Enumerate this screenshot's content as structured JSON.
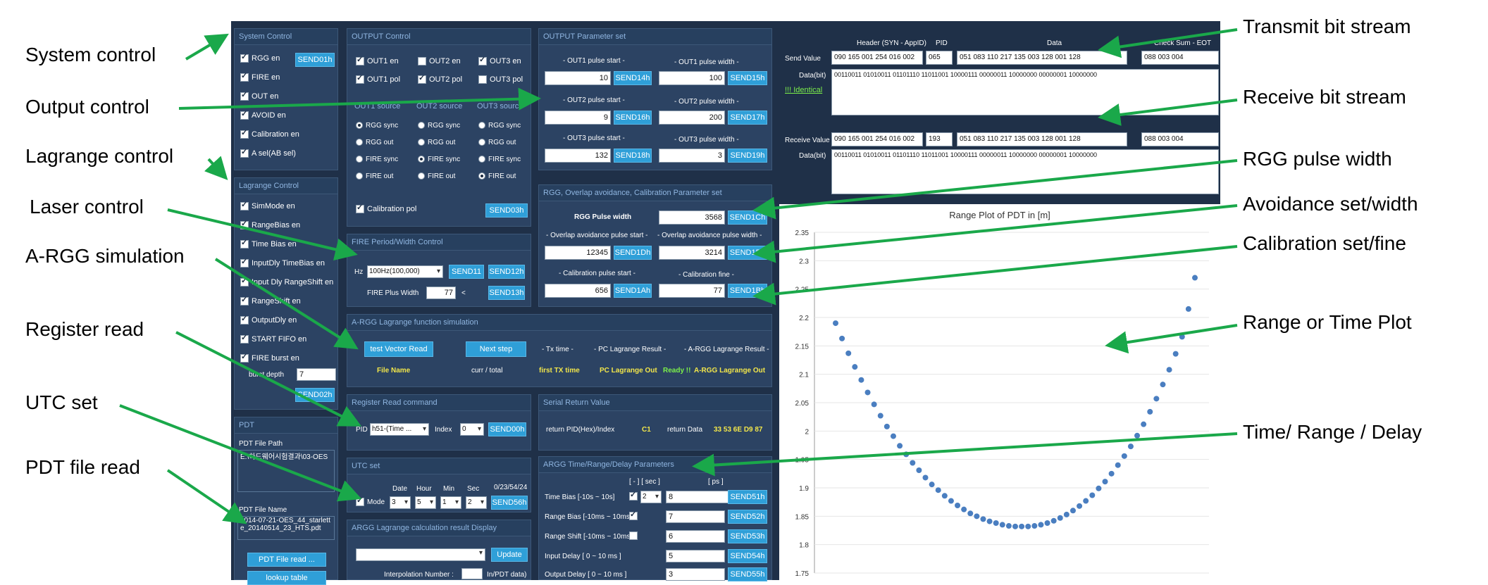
{
  "system": {
    "title": "System Control",
    "items": [
      "RGG en",
      "FIRE en",
      "OUT en",
      "AVOID en",
      "Calibration en",
      "A sel(AB sel)"
    ],
    "send": "SEND01h"
  },
  "lagrange_ctrl": {
    "title": "Lagrange Control",
    "items": [
      "SimMode en",
      "RangeBias en",
      "Time Bias en",
      "InputDly TimeBias en",
      "Input Dly RangeShift en",
      "RangeShift en",
      "OutputDly en",
      "START FIFO en",
      "FIRE burst en"
    ],
    "burst_label": "burst depth",
    "burst_value": "7",
    "send": "SEND02h"
  },
  "pdt": {
    "title": "PDT",
    "path_label": "PDT File Path",
    "path_value": "E:\\하드웨어시험결과\\03-OES",
    "name_label": "PDT File Name",
    "name_value": "2014-07-21-OES_44_starlette_20140514_23_HTS.pdt",
    "read_btn": "PDT File read ...",
    "lookup_btn": "lookup table"
  },
  "output_ctrl": {
    "title": "OUTPUT Control",
    "row1": [
      "OUT1 en",
      "OUT2 en",
      "OUT3 en"
    ],
    "row2": [
      "OUT1 pol",
      "OUT2 pol",
      "OUT3 pol"
    ],
    "src_heads": [
      "OUT1 source",
      "OUT2 source",
      "OUT3 source"
    ],
    "src_opts": [
      "RGG sync",
      "RGG out",
      "FIRE sync",
      "FIRE out"
    ],
    "cal_pol": "Calibration pol",
    "send": "SEND03h"
  },
  "fire": {
    "title": "FIRE Period/Width Control",
    "hz": "Hz",
    "hz_value": "100Hz(100,000)",
    "send11": "SEND11",
    "send12": "SEND12h",
    "width_label": "FIRE Plus Width",
    "width_value": "77",
    "lt": "<",
    "send13": "SEND13h"
  },
  "out_param": {
    "title": "OUTPUT Parameter set",
    "rows": [
      {
        "l_label": "- OUT1 pulse start -",
        "l_val": "10",
        "l_btn": "SEND14h",
        "r_label": "- OUT1 pulse width -",
        "r_val": "100",
        "r_btn": "SEND15h"
      },
      {
        "l_label": "- OUT2 pulse start -",
        "l_val": "9",
        "l_btn": "SEND16h",
        "r_label": "- OUT2 pulse width -",
        "r_val": "200",
        "r_btn": "SEND17h"
      },
      {
        "l_label": "- OUT3 pulse start -",
        "l_val": "132",
        "l_btn": "SEND18h",
        "r_label": "- OUT3 pulse width -",
        "r_val": "3",
        "r_btn": "SEND19h"
      }
    ]
  },
  "rgg_param": {
    "title": "RGG, Overlap avoidance, Calibration Parameter set",
    "pw_label": "RGG Pulse width",
    "pw_val": "3568",
    "pw_btn": "SEND1Ch",
    "oa_start_label": "- Overlap avoidance pulse start -",
    "oa_width_label": "- Overlap avoidance pulse width -",
    "oa_start_val": "12345",
    "oa_start_btn": "SEND1Dh",
    "oa_width_val": "3214",
    "oa_width_btn": "SEND1Eh",
    "cal_start_label": "- Calibration pulse start -",
    "cal_fine_label": "- Calibration fine -",
    "cal_start_val": "656",
    "cal_start_btn": "SEND1Ah",
    "cal_fine_val": "77",
    "cal_fine_btn": "SEND1Bh"
  },
  "argg_sim": {
    "title": "A-RGG Lagrange function simulation",
    "btn_test": "test Vector Read",
    "btn_next": "Next step",
    "tx_time": "- Tx time -",
    "pc_result": "- PC Lagrange Result -",
    "argg_result": "- A-RGG Lagrange Result -",
    "file_name": "File Name",
    "curr_total": "curr / total",
    "first_tx": "first TX time",
    "pc_out": "PC Lagrange Out",
    "ready": "Ready !!",
    "argg_out": "A-RGG Lagrange Out"
  },
  "reg_read": {
    "title": "Register Read command",
    "pid": "PID",
    "pid_val": "h51-(Time ...",
    "index": "Index",
    "index_val": "0",
    "send": "SEND00h"
  },
  "serial": {
    "title": "Serial Return Value",
    "ret_pid": "return PID(Hex)/Index",
    "ret_pid_val": "C1",
    "ret_data": "return Data",
    "ret_data_val": "33 53 6E D9 87"
  },
  "utc": {
    "title": "UTC set",
    "heads": [
      "Date",
      "Hour",
      "Min",
      "Sec"
    ],
    "display": "0/23/54/24",
    "mode": "Mode",
    "vals": [
      "3",
      "5",
      "1",
      "2"
    ],
    "send": "SEND56h"
  },
  "argg_calc": {
    "title": "ARGG Lagrange calculation result Display",
    "update": "Update",
    "interp": "Interpolation Number :",
    "pdt_data": "In/PDT data)"
  },
  "trd": {
    "title": "ARGG Time/Range/Delay Parameters",
    "hdr1": "[ - ]  [ sec ]",
    "hdr2": "[ ps ]",
    "rows": [
      {
        "label": "Time Bias [-10s ~ 10s]",
        "sec": "2",
        "val": "8",
        "btn": "SEND51h"
      },
      {
        "label": "Range Bias [-10ms ~ 10ms",
        "val": "7",
        "btn": "SEND52h"
      },
      {
        "label": "Range Shift [-10ms ~ 10ms",
        "val": "6",
        "btn": "SEND53h"
      },
      {
        "label": "Input Delay [ 0 ~ 10 ms ]",
        "val": "5",
        "btn": "SEND54h"
      },
      {
        "label": "Output Delay [ 0 ~ 10 ms ]",
        "val": "3",
        "btn": "SEND55h"
      }
    ]
  },
  "stream": {
    "hdr_header": "Header (SYN - AppID)",
    "hdr_pid": "PID",
    "hdr_data": "Data",
    "hdr_chk": "Check Sum - EOT",
    "send_label": "Send Value",
    "send_vals": [
      "090 165 001 254 016 002",
      "065",
      "051 083 110 217 135 003 128 001 128",
      "088 003 004"
    ],
    "data_bit": "Data(bit)",
    "send_bits": "00110011 01010011 01101110 11011001 10000111 00000011 10000000 00000001 10000000",
    "identical": "!!! Identical",
    "recv_label": "Receive Value",
    "recv_vals": [
      "090 165 001 254 016 002",
      "193",
      "051 083 110 217 135 003 128 001 128",
      "088 003 004"
    ],
    "recv_bits": "00110011 01010011 01101110 11011001 10000111 00000011 10000000 00000001 10000000"
  },
  "chart_data": {
    "type": "scatter",
    "title": "Range Plot of PDT in [m]",
    "xlabel": "",
    "ylabel": "",
    "ylim": [
      1.75,
      2.35
    ],
    "yticks": [
      "2.35",
      "2.3",
      "2.25",
      "2.2",
      "2.15",
      "2.1",
      "2.05",
      "2",
      "1.95",
      "1.9",
      "1.85",
      "1.8",
      "1.75"
    ],
    "series": [
      {
        "x": [
          0,
          1,
          2,
          3,
          4,
          5,
          6,
          7,
          8,
          9,
          10,
          11,
          12,
          13,
          14,
          15,
          16,
          17,
          18,
          19,
          20,
          21,
          22,
          23,
          24,
          25,
          26,
          27,
          28,
          29,
          30,
          31,
          32,
          33,
          34,
          35,
          36,
          37,
          38,
          39,
          40,
          41,
          42,
          43,
          44,
          45,
          46,
          47,
          48,
          49,
          50,
          51,
          52,
          53,
          54,
          55,
          56
        ],
        "y": [
          2.19,
          2.163,
          2.137,
          2.113,
          2.09,
          2.068,
          2.047,
          2.027,
          2.008,
          1.991,
          1.974,
          1.959,
          1.944,
          1.931,
          1.918,
          1.906,
          1.896,
          1.886,
          1.877,
          1.869,
          1.862,
          1.855,
          1.85,
          1.845,
          1.841,
          1.838,
          1.835,
          1.833,
          1.832,
          1.832,
          1.832,
          1.833,
          1.835,
          1.838,
          1.842,
          1.847,
          1.853,
          1.86,
          1.868,
          1.877,
          1.887,
          1.899,
          1.911,
          1.925,
          1.94,
          1.956,
          1.973,
          1.992,
          2.012,
          2.034,
          2.057,
          2.082,
          2.108,
          2.136,
          2.166,
          2.215,
          2.27
        ]
      }
    ]
  },
  "annotations": {
    "left": [
      "System control",
      "Output control",
      "Lagrange control",
      "Laser control",
      "A-RGG simulation",
      "Register read",
      "UTC set",
      "PDT file read"
    ],
    "right": [
      "Transmit bit stream",
      "Receive bit stream",
      "RGG pulse width",
      "Avoidance set/width",
      "Calibration set/fine",
      "Range or Time Plot",
      "Time/ Range / Delay"
    ]
  },
  "colors": {
    "arrow": "#1aa84a",
    "panel": "#2c4363",
    "button": "#2f9fd8",
    "highlight": "#f2e64a"
  }
}
